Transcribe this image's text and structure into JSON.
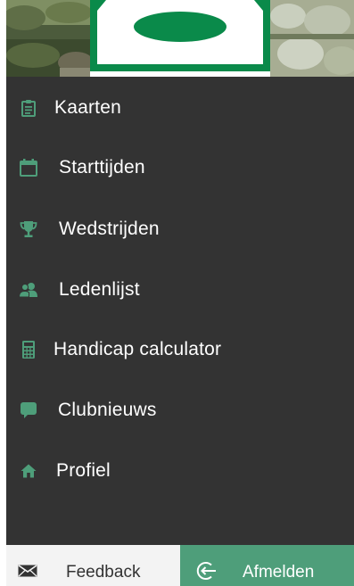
{
  "colors": {
    "drawer_background": "#333333",
    "icon_accent": "#4e9e7a",
    "logout_background": "#4e9e7a",
    "feedback_background": "#f3f3f3",
    "logo_green": "#0a8a4a"
  },
  "menu": {
    "items": [
      {
        "label": "Kaarten",
        "icon": "clipboard-icon"
      },
      {
        "label": "Starttijden",
        "icon": "calendar-icon"
      },
      {
        "label": "Wedstrijden",
        "icon": "trophy-icon"
      },
      {
        "label": "Ledenlijst",
        "icon": "users-icon"
      },
      {
        "label": "Handicap calculator",
        "icon": "calculator-icon"
      },
      {
        "label": "Clubnieuws",
        "icon": "speech-bubble-icon"
      },
      {
        "label": "Profiel",
        "icon": "home-icon"
      }
    ]
  },
  "footer": {
    "feedback_label": "Feedback",
    "feedback_icon": "envelope-icon",
    "logout_label": "Afmelden",
    "logout_icon": "logout-icon"
  }
}
